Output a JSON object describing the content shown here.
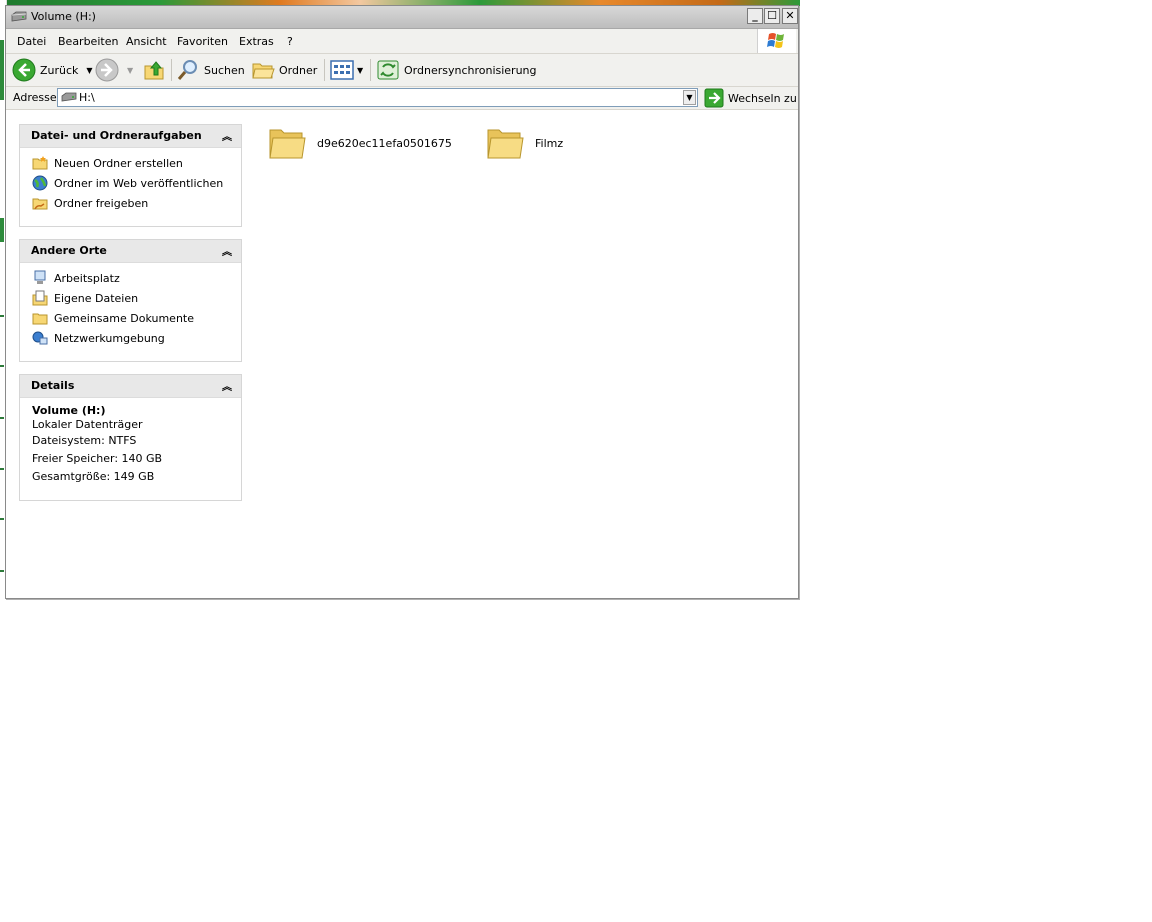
{
  "window": {
    "title": "Volume (H:)",
    "controls": {
      "minimize": "_",
      "maximize": "☐",
      "close": "✕"
    }
  },
  "menu": [
    "Datei",
    "Bearbeiten",
    "Ansicht",
    "Favoriten",
    "Extras",
    "?"
  ],
  "toolbar": {
    "back_label": "Zurück",
    "search_label": "Suchen",
    "folders_label": "Ordner",
    "sync_label": "Ordnersynchronisierung"
  },
  "address": {
    "label": "Adresse",
    "value": "H:\\",
    "go_label": "Wechseln zu"
  },
  "panels": {
    "tasks": {
      "title": "Datei- und Ordneraufgaben",
      "items": [
        "Neuen Ordner erstellen",
        "Ordner im Web veröffentlichen",
        "Ordner freigeben"
      ]
    },
    "places": {
      "title": "Andere Orte",
      "items": [
        "Arbeitsplatz",
        "Eigene Dateien",
        "Gemeinsame Dokumente",
        "Netzwerkumgebung"
      ]
    },
    "details": {
      "title": "Details",
      "name": "Volume (H:)",
      "type": "Lokaler Datenträger",
      "filesystem": "Dateisystem: NTFS",
      "free": "Freier Speicher: 140 GB",
      "total": "Gesamtgröße: 149 GB"
    }
  },
  "folders": [
    "d9e620ec11efa0501675",
    "Filmz"
  ],
  "colors": {
    "titlebar": "#c8c8c8",
    "menubar": "#f1f1ee",
    "panel_header": "#e8e8e8",
    "folder_yellow": "#f7d774",
    "go_green": "#3aa832"
  }
}
